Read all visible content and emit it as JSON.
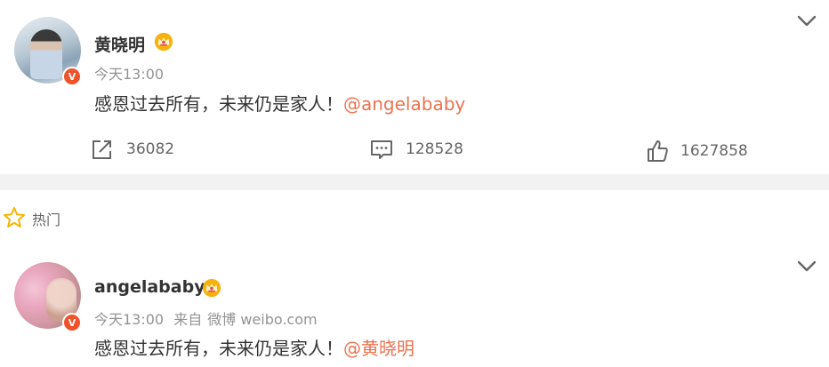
{
  "posts": [
    {
      "username": "黄晓明",
      "time": "今天13:00",
      "content_text": "感恩过去所有，未来仍是家人！",
      "mention": "@angelababy",
      "verified_badge": "V",
      "stats": {
        "repost": "36082",
        "comment": "128528",
        "like": "1627858"
      }
    },
    {
      "username": "angelababy",
      "time": "今天13:00",
      "source_prefix": "来自",
      "source": "微博 weibo.com",
      "content_text": "感恩过去所有，未来仍是家人！",
      "mention": "@黄晓明",
      "verified_badge": "V"
    }
  ],
  "hot_section": {
    "label": "热门"
  },
  "colors": {
    "accent": "#eb7350",
    "verified": "#f0522b",
    "crown": "#f6b10a",
    "star": "#f7b500"
  }
}
